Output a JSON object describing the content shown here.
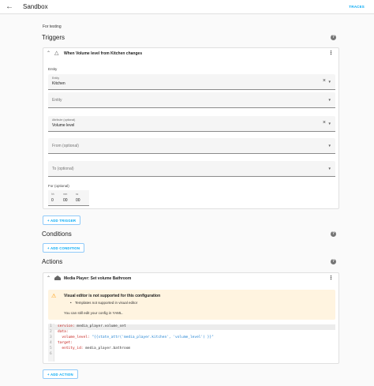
{
  "header": {
    "back_icon": "arrow-left-icon",
    "title": "Sandbox",
    "traces_label": "TRACES"
  },
  "description": "For testing",
  "triggers": {
    "heading": "Triggers",
    "card": {
      "title": "When Volume level from Kitchen changes",
      "entity_section_label": "Entity",
      "fields": [
        {
          "label": "Entity",
          "value": "Kitchen",
          "placeholder": ""
        },
        {
          "label": "",
          "value": "",
          "placeholder": "Entity"
        },
        {
          "label": "Attribute (optional)",
          "value": "Volume level",
          "placeholder": ""
        },
        {
          "label": "",
          "value": "",
          "placeholder": "From (optional)"
        },
        {
          "label": "",
          "value": "",
          "placeholder": "To (optional)"
        }
      ],
      "for_label": "For (optional)",
      "duration": [
        {
          "unit": "hh",
          "value": "0"
        },
        {
          "unit": "mm",
          "value": "00"
        },
        {
          "unit": "ss",
          "value": "00"
        }
      ]
    },
    "add_label": "+ ADD TRIGGER"
  },
  "conditions": {
    "heading": "Conditions",
    "add_label": "+ ADD CONDITION"
  },
  "actions": {
    "heading": "Actions",
    "card": {
      "title": "Media Player: Set volume Bathroom",
      "alert": {
        "title": "Visual editor is not supported for this configuration",
        "bullet": "Templates not supported in visual editor",
        "body": "You can still edit your config in YAML."
      },
      "code_lines": [
        {
          "n": "1",
          "key": "service:",
          "val": " media_player.volume_set"
        },
        {
          "n": "2",
          "key": "data:",
          "val": ""
        },
        {
          "n": "3",
          "key": "  volume_level:",
          "val": " \"{{state_attr('media_player.kitchen', 'volume_level') }}\""
        },
        {
          "n": "4",
          "key": "target:",
          "val": ""
        },
        {
          "n": "5",
          "key": "  entity_id:",
          "val": " media_player.bathroom"
        },
        {
          "n": "6",
          "key": "",
          "val": ""
        }
      ]
    },
    "add_label": "+ ADD ACTION"
  },
  "icons": {
    "help": "help-circle-icon",
    "chevron": "chevron-up-icon",
    "menu": "dots-vertical-icon",
    "clear": "close-icon",
    "dropdown": "menu-down-icon"
  },
  "colors": {
    "accent": "#03a9f4",
    "warning": "#ff9800",
    "warning_bg": "#fff4e0"
  }
}
